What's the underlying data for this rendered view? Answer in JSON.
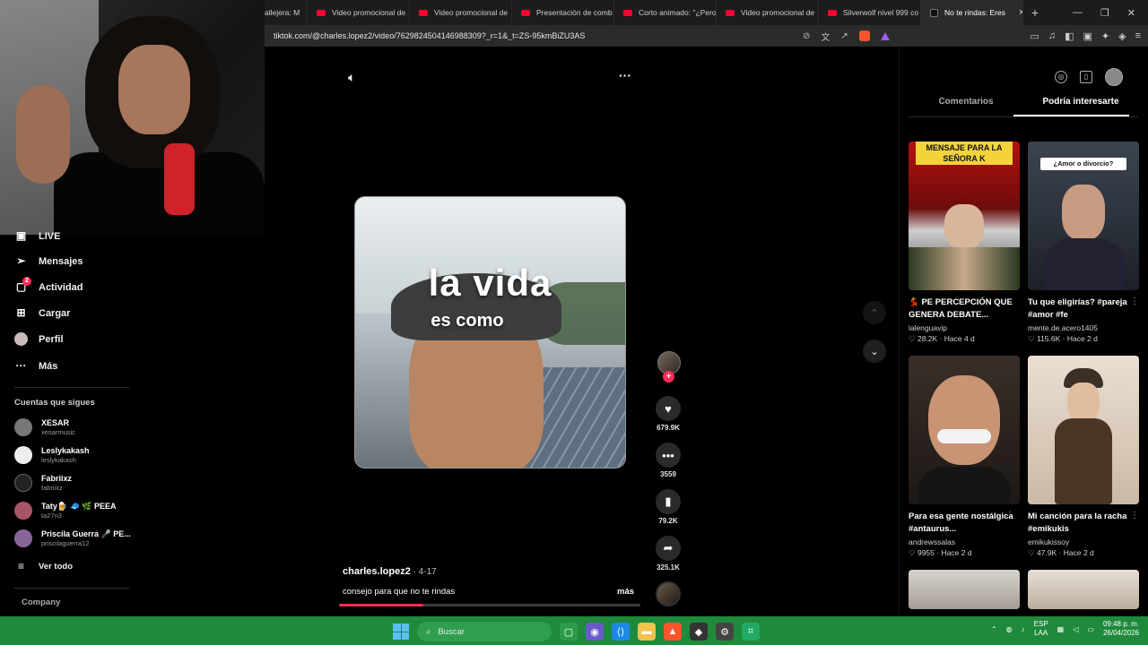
{
  "browser": {
    "tabs": [
      {
        "label": "allejera: M",
        "active": false,
        "icon": "youtube-icon"
      },
      {
        "label": "Video promocional de",
        "active": false,
        "icon": "youtube-icon"
      },
      {
        "label": "Video promocional de",
        "active": false,
        "icon": "youtube-icon"
      },
      {
        "label": "Presentación de comb",
        "active": false,
        "icon": "youtube-icon"
      },
      {
        "label": "Corto animado: \"¿Pero",
        "active": false,
        "icon": "youtube-icon"
      },
      {
        "label": "Video promocional de",
        "active": false,
        "icon": "youtube-icon"
      },
      {
        "label": "Silverwolf nivel 999 co",
        "active": false,
        "icon": "youtube-icon"
      },
      {
        "label": "No te rindas: Eres",
        "active": true,
        "icon": "tiktok-icon"
      }
    ],
    "tab_close": "×",
    "new_tab": "+",
    "url": "tiktok.com/@charles.lopez2/video/7629824504146988309?_r=1&_t=ZS-95kmBiZU3AS",
    "window_controls": {
      "minimize": "—",
      "restore": "❐",
      "close": "✕"
    }
  },
  "sidebar": {
    "live_label": "LIVE",
    "items": [
      {
        "label": "Mensajes",
        "icon": "messages-icon"
      },
      {
        "label": "Actividad",
        "icon": "activity-icon",
        "badge": "2"
      },
      {
        "label": "Cargar",
        "icon": "upload-icon"
      },
      {
        "label": "Perfil",
        "icon": "profile-icon"
      },
      {
        "label": "Más",
        "icon": "more-icon"
      }
    ],
    "following_title": "Cuentas que sigues",
    "following": [
      {
        "name": "XESAR",
        "handle": "xesarmusic"
      },
      {
        "name": "Leslykakash",
        "handle": "leslykakash"
      },
      {
        "name": "Fabriixz",
        "handle": "fabriixz"
      },
      {
        "name": "Taty🍺 🧢 🌿 PEEA",
        "handle": "ta27n3"
      },
      {
        "name": "Priscila Guerra 🎤 PE...",
        "handle": "priscilaguerra12"
      }
    ],
    "see_all": "Ver todo",
    "company": "Company"
  },
  "video": {
    "overlay_line1": "la vida",
    "overlay_line2": "es como",
    "author": "charles.lopez2",
    "date": " · 4-17",
    "caption": "consejo para que no te rindas",
    "more": "más",
    "progress": 0.28,
    "likes": "679.9K",
    "comments": "3559",
    "saves": "79.2K",
    "shares": "325.1K",
    "follow_plus": "+"
  },
  "right_panel": {
    "tabs": [
      {
        "label": "Comentarios",
        "active": false
      },
      {
        "label": "Podría interesarte",
        "active": true
      }
    ],
    "cards": [
      {
        "title": "💃 PE PERCEPCIÓN QUE GENERA DEBATE...",
        "author": "lalenguavip",
        "stats": "♡ 28.2K  · Hace 4 d",
        "thumb_text": "MENSAJE PARA LA SEÑORA K"
      },
      {
        "title": "Tu que eligirías? #pareja #amor #fe",
        "author": "mente.de.acero1405",
        "stats": "♡ 115.6K · Hace 2 d",
        "thumb_text": "¿Amor o divorcio?"
      },
      {
        "title": "Para esa gente nostálgica #antaurus...",
        "author": "andrewssalas",
        "stats": "♡ 9955 · Hace 2 d",
        "thumb_text": ""
      },
      {
        "title": "Mi canción para la racha #emikukis",
        "author": "emikukissoy",
        "stats": "♡ 47.9K · Hace 2 d",
        "thumb_text": ""
      }
    ]
  },
  "taskbar": {
    "search_label": "Buscar",
    "lang_top": "ESP",
    "lang_bottom": "LAA",
    "time": "09:48 p. m.",
    "date": "26/04/2026"
  },
  "colors": {
    "accent": "#fe2c55",
    "taskbar": "#1f8a3c",
    "youtube": "#ff0033"
  }
}
